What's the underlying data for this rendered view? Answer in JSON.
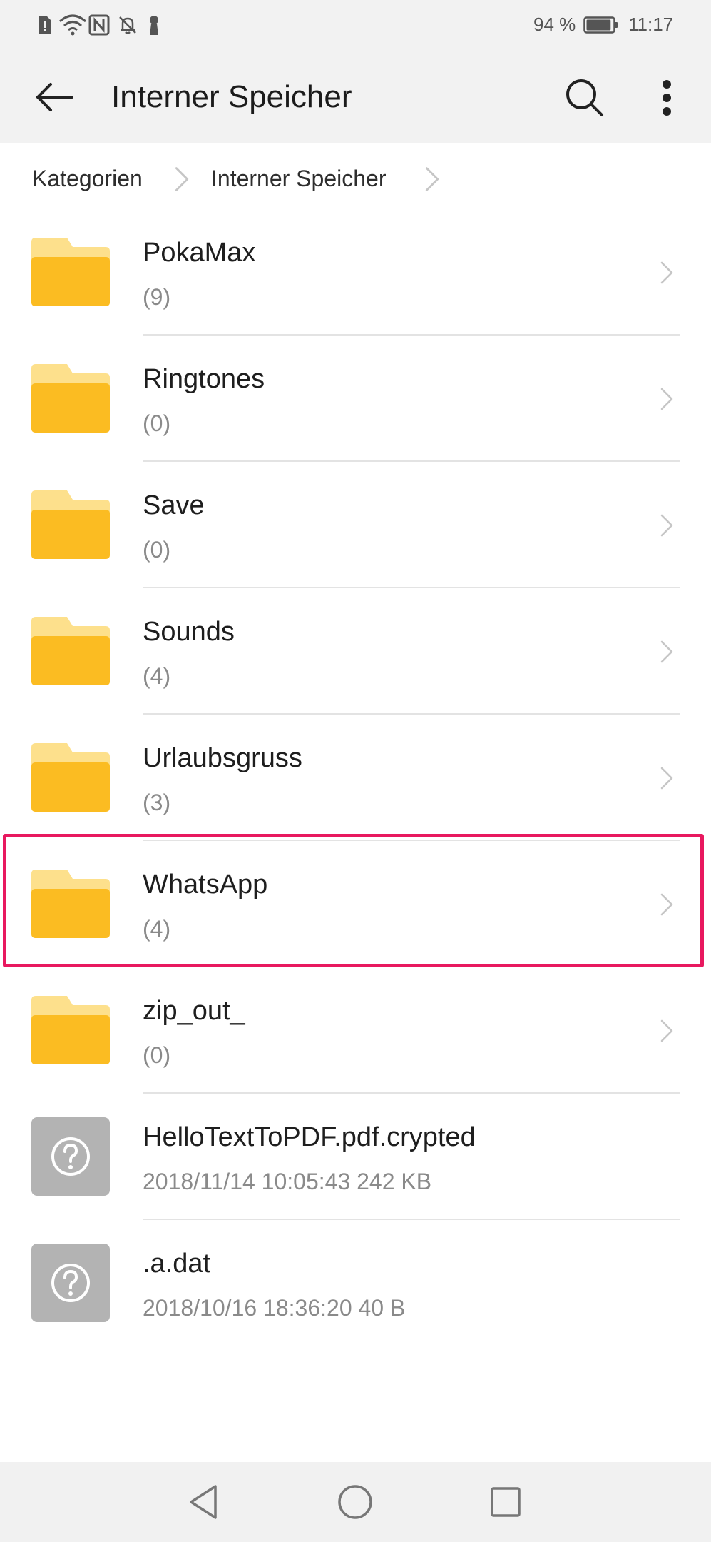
{
  "status_bar": {
    "battery_percent": "94 %",
    "battery_level": 0.94,
    "time": "11:17",
    "icons": [
      "sim-alert-icon",
      "wifi-icon",
      "nfc-icon",
      "bell-off-icon",
      "key-icon",
      "battery-icon"
    ]
  },
  "app_bar": {
    "title": "Interner Speicher",
    "icons": [
      "back-arrow-icon",
      "search-icon",
      "more-vert-icon"
    ]
  },
  "breadcrumb": {
    "items": [
      {
        "label": "Kategorien"
      },
      {
        "label": "Interner Speicher"
      }
    ]
  },
  "files": [
    {
      "name": "PokaMax",
      "detail": "(9)",
      "icon": "folder-icon"
    },
    {
      "name": "Ringtones",
      "detail": "(0)",
      "icon": "folder-icon"
    },
    {
      "name": "Save",
      "detail": "(0)",
      "icon": "folder-icon"
    },
    {
      "name": "Sounds",
      "detail": "(4)",
      "icon": "folder-icon"
    },
    {
      "name": "Urlaubsgruss",
      "detail": "(3)",
      "icon": "folder-icon"
    },
    {
      "name": "WhatsApp",
      "detail": "(4)",
      "icon": "folder-icon"
    },
    {
      "name": "zip_out_",
      "detail": "(0)",
      "icon": "folder-icon"
    },
    {
      "name": "HelloTextToPDF.pdf.crypted",
      "detail": "2018/11/14 10:05:43 242 KB",
      "icon": "unknown-file-icon"
    },
    {
      "name": ".a.dat",
      "detail": "2018/10/16 18:36:20 40 B",
      "icon": "unknown-file-icon"
    }
  ],
  "highlight": {
    "item": "WhatsApp",
    "color": "#e8185f"
  },
  "colors": {
    "folder_front": "#fbbc22",
    "folder_back": "#fde08c",
    "unknown_file": "#b3b3b3",
    "header_bg": "#f2f2f2"
  },
  "nav_bar": {
    "icons": [
      "nav-back-icon",
      "nav-home-icon",
      "nav-recents-icon"
    ]
  }
}
